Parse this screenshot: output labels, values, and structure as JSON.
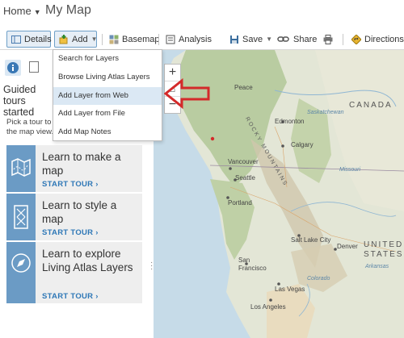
{
  "header": {
    "home_label": "Home",
    "map_title": "My Map"
  },
  "toolbar": {
    "details": "Details",
    "add": "Add",
    "basemap": "Basemap",
    "analysis": "Analysis",
    "save": "Save",
    "share": "Share",
    "directions": "Directions"
  },
  "add_menu": {
    "items": [
      "Search for Layers",
      "Browse Living Atlas Layers",
      "Add Layer from Web",
      "Add Layer from File",
      "Add Map Notes"
    ],
    "highlighted_index": 2
  },
  "side_panel": {
    "guided_tours_title": "Guided tours started",
    "pick_text": "Pick a tour to the map view.",
    "tours": [
      {
        "title": "Learn to make a map",
        "action": "START TOUR ›",
        "icon": "map-icon"
      },
      {
        "title": "Learn to style a map",
        "action": "START TOUR ›",
        "icon": "style-icon"
      },
      {
        "title": "Learn to explore Living Atlas Layers",
        "action": "START TOUR ›",
        "icon": "compass-icon"
      }
    ]
  },
  "map": {
    "zoom_in": "+",
    "zoom_out": "−",
    "labels": {
      "canada": "CANADA",
      "united_states": "UNITED STATES",
      "rocky_mountains": "ROCKY MOUNTAINS",
      "edmonton": "Edmonton",
      "calgary": "Calgary",
      "vancouver": "Vancouver",
      "seattle": "Seattle",
      "portland": "Portland",
      "salt_lake_city": "Salt Lake City",
      "denver": "Denver",
      "san_francisco": "San Francisco",
      "las_vegas": "Las Vegas",
      "los_angeles": "Los Angeles",
      "peace": "Peace",
      "saskatchewan": "Saskatchewan",
      "missouri": "Missouri",
      "colorado": "Colorado",
      "arkansas": "Arkansas"
    }
  },
  "colors": {
    "accent": "#2f78b7",
    "tour_icon_bg": "#6b9bc5",
    "menu_highlight": "#dbe8f4",
    "annotation_arrow": "#d42a2a"
  }
}
